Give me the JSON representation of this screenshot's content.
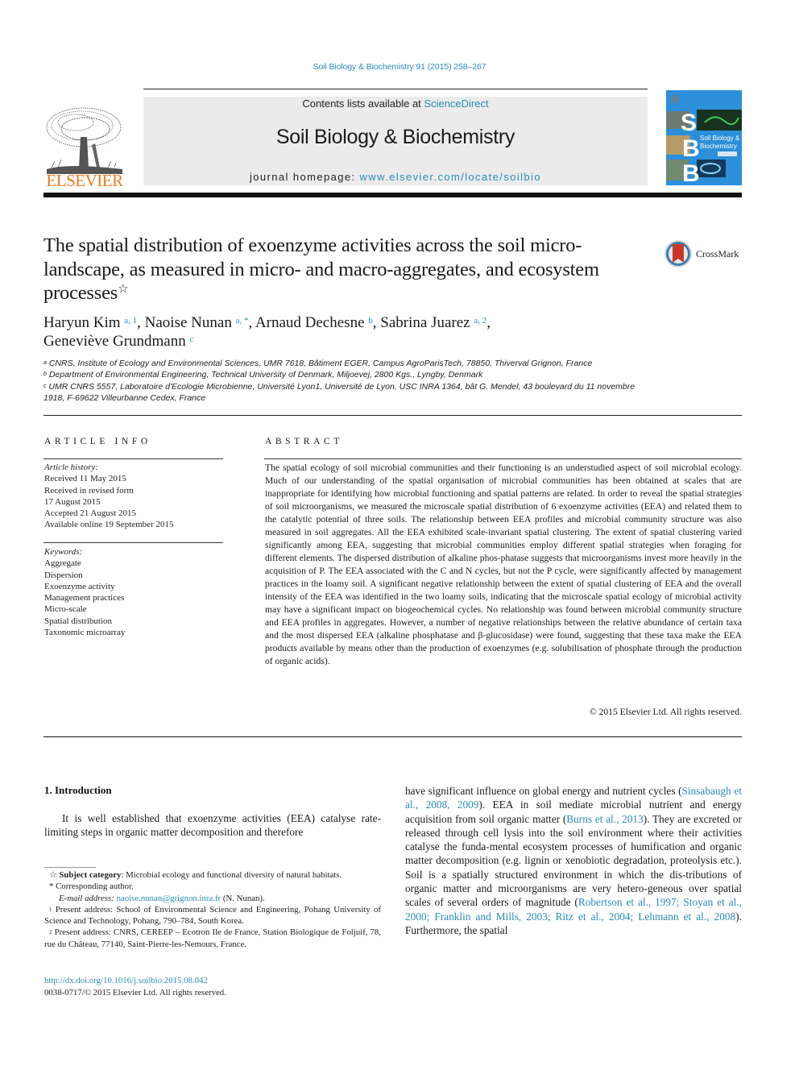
{
  "running_head": "Soil Biology & Biochemistry 91 (2015) 258–267",
  "masthead": {
    "publisher_logo_text": "ELSEVIER",
    "contents_prefix": "Contents lists available at ",
    "contents_link": "ScienceDirect",
    "journal_name": "Soil Biology & Biochemistry",
    "homepage_prefix": "journal homepage: ",
    "homepage_link": "www.elsevier.com/locate/soilbio",
    "cover_letters": [
      "S",
      "B",
      "B"
    ],
    "cover_title_line1": "Soil Biology &",
    "cover_title_line2": "Biochemistry"
  },
  "crossmark": {
    "label": "CrossMark"
  },
  "title": "The spatial distribution of exoenzyme activities across the soil micro-landscape, as measured in micro- and macro-aggregates, and ecosystem processes",
  "title_note_mark": "☆",
  "authors": [
    {
      "name": "Haryun Kim",
      "marks": "a, 1",
      "sep": ", "
    },
    {
      "name": "Naoise Nunan",
      "marks": "a, *",
      "sep": ", "
    },
    {
      "name": "Arnaud Dechesne",
      "marks": "b",
      "sep": ", "
    },
    {
      "name": "Sabrina Juarez",
      "marks": "a, 2",
      "sep": ","
    },
    {
      "name": "Geneviève Grundmann",
      "marks": "c",
      "sep": ""
    }
  ],
  "affiliations": [
    {
      "mark": "a",
      "text": "CNRS, Institute of Ecology and Environmental Sciences, UMR 7618, Bâtiment EGER, Campus AgroParisTech, 78850, Thiverval Grignon, France"
    },
    {
      "mark": "b",
      "text": "Department of Environmental Engineering, Technical University of Denmark, Miljoevej, 2800 Kgs., Lyngby, Denmark"
    },
    {
      "mark": "c",
      "text": "UMR CNRS 5557, Laboratoire d'Ecologie Microbienne, Université Lyon1, Université de Lyon, USC INRA 1364, bât G. Mendel, 43 boulevard du 11 novembre 1918, F-69622 Villeurbanne Cedex, France"
    }
  ],
  "article_info": {
    "heading": "ARTICLE INFO",
    "history_label": "Article history:",
    "history": [
      "Received 11 May 2015",
      "Received in revised form",
      "17 August 2015",
      "Accepted 21 August 2015",
      "Available online 19 September 2015"
    ],
    "keywords_label": "Keywords:",
    "keywords": [
      "Aggregate",
      "Dispersion",
      "Exoenzyme activity",
      "Management practices",
      "Micro-scale",
      "Spatial distribution",
      "Taxonomic microarray"
    ]
  },
  "abstract": {
    "heading": "ABSTRACT",
    "text": "The spatial ecology of soil microbial communities and their functioning is an understudied aspect of soil microbial ecology. Much of our understanding of the spatial organisation of microbial communities has been obtained at scales that are inappropriate for identifying how microbial functioning and spatial patterns are related. In order to reveal the spatial strategies of soil microorganisms, we measured the microscale spatial distribution of 6 exoenzyme activities (EEA) and related them to the catalytic potential of three soils. The relationship between EEA profiles and microbial community structure was also measured in soil aggregates. All the EEA exhibited scale-invariant spatial clustering. The extent of spatial clustering varied significantly among EEA, suggesting that microbial communities employ different spatial strategies when foraging for different elements. The dispersed distribution of alkaline phos-phatase suggests that microorganisms invest more heavily in the acquisition of P. The EEA associated with the C and N cycles, but not the P cycle, were significantly affected by management practices in the loamy soil. A significant negative relationship between the extent of spatial clustering of EEA and the overall intensity of the EEA was identified in the two loamy soils, indicating that the microscale spatial ecology of microbial activity may have a significant impact on biogeochemical cycles. No relationship was found between microbial community structure and EEA profiles in aggregates. However, a number of negative relationships between the relative abundance of certain taxa and the most dispersed EEA (alkaline phosphatase and β-glucosidase) were found, suggesting that these taxa make the EEA products available by means other than the production of exoenzymes (e.g. solubilisation of phosphate through the production of organic acids).",
    "copyright": "© 2015 Elsevier Ltd. All rights reserved."
  },
  "introduction": {
    "heading": "1.  Introduction",
    "left_text": "It is well established that exoenzyme activities (EEA) catalyse rate-limiting steps in organic matter decomposition and therefore",
    "right": {
      "t1": "have significant influence on global energy and nutrient cycles (",
      "ref1": "Sinsabaugh et al., 2008, 2009",
      "t2": "). EEA in soil mediate microbial nutrient and energy acquisition from soil organic matter (",
      "ref2": "Burns et al., 2013",
      "t3": "). They are excreted or released through cell lysis into the soil environment where their activities catalyse the funda-mental ecosystem processes of humification and organic matter decomposition (e.g. lignin or xenobiotic degradation, proteolysis etc.). Soil is a spatially structured environment in which the dis-tributions of organic matter and microorganisms are very hetero-geneous over spatial scales of several orders of magnitude (",
      "ref3": "Robertson et al., 1997",
      "sep3": "; ",
      "ref4": "Stoyan et al., 2000",
      "sep4": "; ",
      "ref5": "Franklin and Mills, 2003",
      "sep5": "; ",
      "ref6": "Ritz et al., 2004",
      "sep6": "; ",
      "ref7": "Lehmann et al., 2008",
      "t4": "). Furthermore, the spatial"
    }
  },
  "footnotes": {
    "subject_mark": "☆",
    "subject_label": "Subject category",
    "subject_text": ": Microbial ecology and functional diversity of natural habitats.",
    "corr_mark": "*",
    "corr_text": "Corresponding author.",
    "email_label": "E-mail address: ",
    "email": "naoise.nunan@grignon.inra.fr",
    "email_suffix": " (N. Nunan).",
    "fn1_mark": "1",
    "fn1_text": "Present address: School of Environmental Science and Engineering, Pohang University of Science and Technology, Pohang, 790–784, South Korea.",
    "fn2_mark": "2",
    "fn2_text": "Present address: CNRS, CEREEP – Ecotron Ile de France, Station Biologique de Foljuif, 78, rue du Château, 77140, Saint-Pierre-les-Nemours, France."
  },
  "doi": "http://dx.doi.org/10.1016/j.soilbio.2015.08.042",
  "issn_line": "0038-0717/© 2015 Elsevier Ltd. All rights reserved.",
  "colors": {
    "link": "#2a8cb8",
    "elsevier_orange": "#f07b1c",
    "masthead_gray": "#ebebeb",
    "cover_blue": "#2b8fd9",
    "crossmark_red": "#c8382a"
  }
}
